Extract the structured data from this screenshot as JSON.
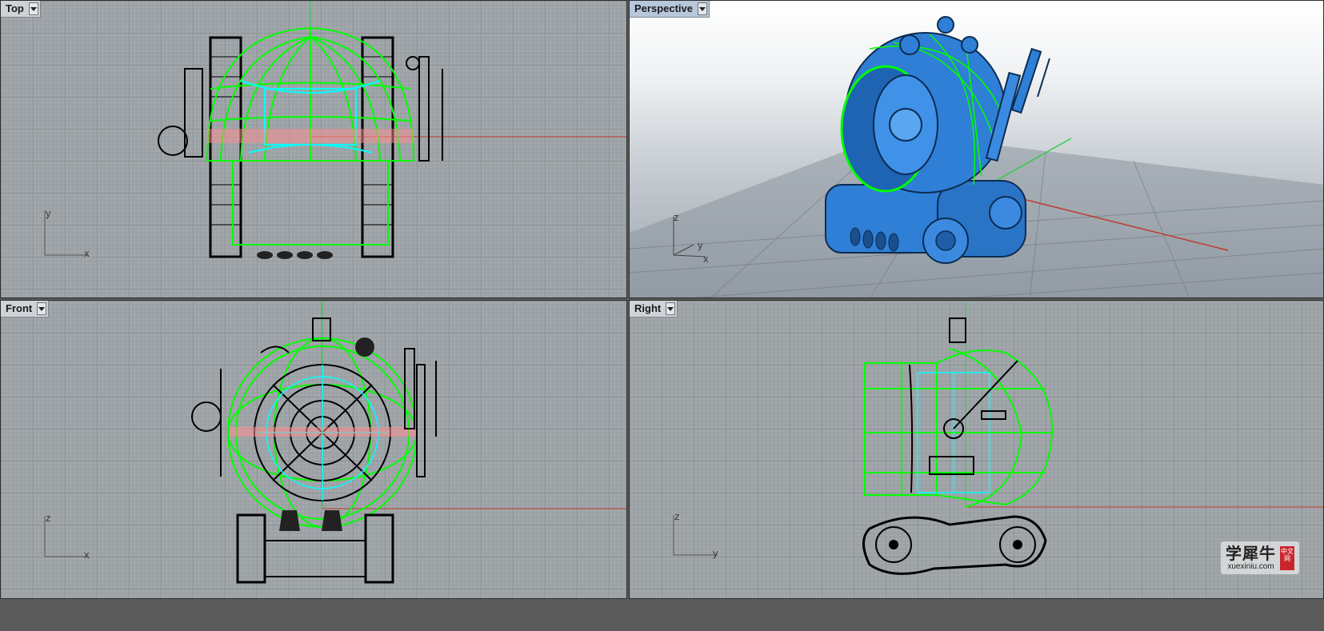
{
  "viewports": {
    "top": {
      "title": "Top",
      "axis_h": "x",
      "axis_v": "y",
      "active": false
    },
    "persp": {
      "title": "Perspective",
      "axis_h": "x",
      "axis_v": "z",
      "axis_d": "y",
      "active": true
    },
    "front": {
      "title": "Front",
      "axis_h": "x",
      "axis_v": "z",
      "active": false
    },
    "right": {
      "title": "Right",
      "axis_h": "y",
      "axis_v": "z",
      "active": false
    }
  },
  "icons": {
    "viewport_menu": "dropdown-arrow-icon"
  },
  "colors": {
    "wire_selected": "#00ff00",
    "wire_default": "#000000",
    "wire_highlight": "#00ffff",
    "x_axis": "#c0392b",
    "y_axis": "#2ecc40",
    "render_blue": "#2f7fd6",
    "grid_bg": "#a2a7ab"
  },
  "watermark": {
    "cn": "学犀牛",
    "url": "xuexiniu.com",
    "seal": "中文网"
  }
}
